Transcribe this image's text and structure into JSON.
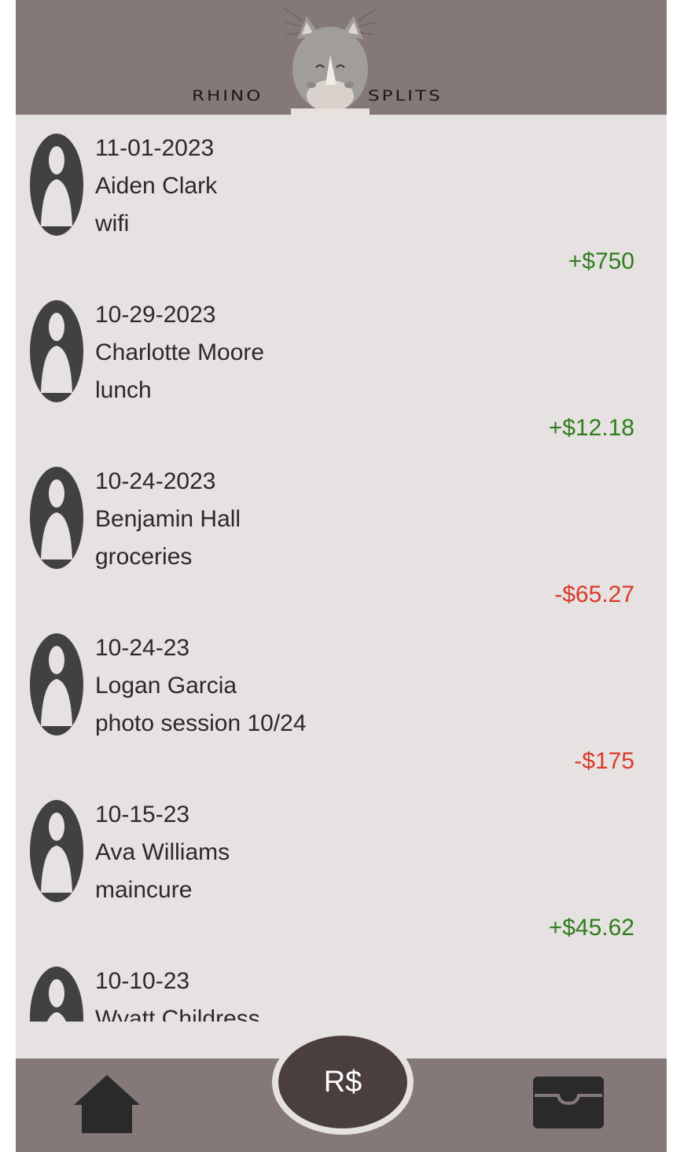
{
  "header": {
    "logo_left": "RHINO",
    "logo_right": "SPLITS"
  },
  "transactions": [
    {
      "date": "11-01-2023",
      "name": "Aiden Clark",
      "desc": "wifi",
      "amount": "+$750",
      "type": "pos"
    },
    {
      "date": "10-29-2023",
      "name": "Charlotte Moore",
      "desc": "lunch",
      "amount": "+$12.18",
      "type": "pos"
    },
    {
      "date": "10-24-2023",
      "name": "Benjamin Hall",
      "desc": "groceries",
      "amount": "-$65.27",
      "type": "neg"
    },
    {
      "date": "10-24-23",
      "name": "Logan Garcia",
      "desc": "photo session 10/24",
      "amount": "-$175",
      "type": "neg"
    },
    {
      "date": "10-15-23",
      "name": "Ava Williams",
      "desc": "maincure",
      "amount": "+$45.62",
      "type": "pos"
    },
    {
      "date": "10-10-23",
      "name": "Wyatt Childress",
      "desc": "",
      "amount": "",
      "type": "pos"
    }
  ],
  "footer": {
    "center_button": "R$",
    "left_icon": "home-icon",
    "right_icon": "wallet-icon"
  },
  "colors": {
    "header_bg": "#857878",
    "list_bg": "#e6e2e1",
    "positive": "#2f7d1e",
    "negative": "#d93a2b",
    "button_bg": "#4a3e3e"
  }
}
